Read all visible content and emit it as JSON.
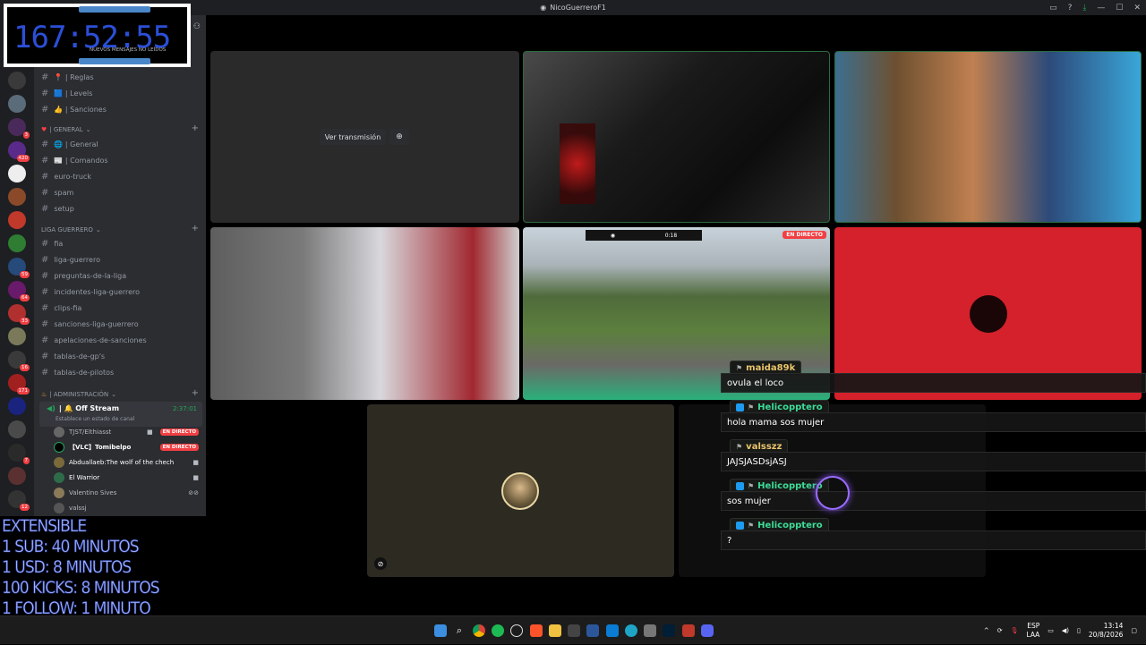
{
  "window": {
    "title": "NicoGuerreroF1"
  },
  "timer": {
    "clock": "167:52:55",
    "next_label": "NUEVOS MENSAJES NO LEÍDOS"
  },
  "server_badges": [
    "3",
    "420",
    "59",
    "64",
    "33",
    "16",
    "171",
    "7",
    "12"
  ],
  "channels": {
    "info": [
      {
        "label": "📍 | Reglas"
      },
      {
        "label": "🟦 | Levels"
      },
      {
        "label": "👍 | Sanciones"
      }
    ],
    "general_cat": "| GENERAL",
    "general": [
      {
        "label": "🌐 | General"
      },
      {
        "label": "📰 | Comandos"
      },
      {
        "label": "euro-truck"
      },
      {
        "label": "spam"
      },
      {
        "label": "setup"
      }
    ],
    "liga_cat": "LIGA GUERRERO",
    "liga": [
      {
        "label": "fia"
      },
      {
        "label": "liga-guerrero"
      },
      {
        "label": "preguntas-de-la-liga"
      },
      {
        "label": "incidentes-liga-guerrero"
      },
      {
        "label": "clips-fia"
      },
      {
        "label": "sanciones-liga-guerrero"
      },
      {
        "label": "apelaciones-de-sanciones"
      },
      {
        "label": "tablas-de-gp's"
      },
      {
        "label": "tablas-de-pilotos"
      }
    ],
    "admin_cat": "| ADMINISTRACIÓN"
  },
  "voice": {
    "channel": "| 🔔 Off Stream",
    "time": "2:37:01",
    "status": "Establece un estado de canal",
    "users": [
      {
        "name": "TJST/Elthiasst",
        "live": "EN DIRECTO"
      },
      {
        "name": "【VLC】Tomibelpo",
        "live": "EN DIRECTO"
      },
      {
        "name": "Abduallaeb:The wolf of the chech",
        "live": ""
      },
      {
        "name": "El Warrior",
        "live": ""
      },
      {
        "name": "Valentino Sives",
        "live": ""
      },
      {
        "name": "valssj",
        "live": ""
      }
    ]
  },
  "overlay": {
    "lines": [
      "EXTENSIBLE",
      "1 SUB: 40 MINUTOS",
      "1 USD: 8 MINUTOS",
      "100 KICKS: 8 MINUTOS",
      "1 FOLLOW: 1 MINUTO"
    ]
  },
  "stream": {
    "watch_button": "Ver transmisión",
    "live_badge": "EN DIRECTO",
    "hud_time": "0:18"
  },
  "chat": [
    {
      "user": "maida89k",
      "color": "#e9c46a",
      "text": "ovula el loco"
    },
    {
      "user": "Helicopptero",
      "color": "#3ddc97",
      "text": "hola mama sos mujer"
    },
    {
      "user": "valsszz",
      "color": "#e9c46a",
      "text": "JAJSJASDsjASJ"
    },
    {
      "user": "Helicopptero",
      "color": "#3ddc97",
      "text": "sos mujer"
    },
    {
      "user": "Helicopptero",
      "color": "#3ddc97",
      "text": "?"
    }
  ],
  "taskbar": {
    "lang1": "ESP",
    "lang2": "LAA",
    "time": "13:14",
    "date": "20/8/2026"
  }
}
